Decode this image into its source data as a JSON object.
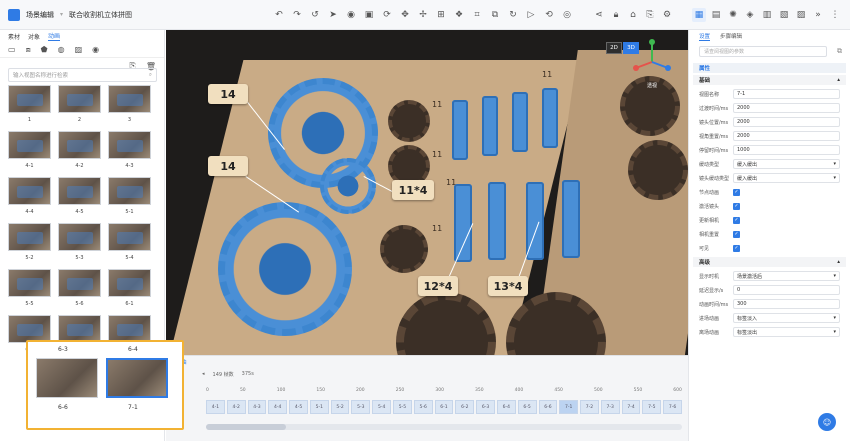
{
  "app": {
    "title": "场景编辑",
    "project": "联合收割机立体拼图"
  },
  "toolbar_icons": [
    "undo-icon",
    "redo-icon",
    "back-icon",
    "cursor-icon",
    "camera-icon",
    "save-icon",
    "rotate-icon",
    "move-icon",
    "scale-icon",
    "grid-icon",
    "explode-icon",
    "crop-icon",
    "link-icon",
    "refresh-icon",
    "play-icon",
    "loop-icon",
    "record-icon"
  ],
  "left": {
    "tabs": [
      "素材",
      "对象",
      "动画"
    ],
    "active_tab": 2,
    "search_placeholder": "输入视图名称进行检索",
    "thumbs": [
      "1",
      "2",
      "3",
      "4-1",
      "4-2",
      "4-3",
      "4-4",
      "4-5",
      "5-1",
      "5-2",
      "5-3",
      "5-4",
      "5-5",
      "5-6",
      "6-1",
      "6-2",
      "6-3",
      "6-4"
    ]
  },
  "canvas": {
    "view_2d": "2D",
    "view_3d": "3D",
    "tags": [
      "14",
      "14",
      "11*4",
      "12*4",
      "13*4"
    ],
    "numbers": [
      "11",
      "11",
      "11",
      "11",
      "11"
    ],
    "gizmo_label": "透视"
  },
  "timeline": {
    "tab": "时间轴",
    "duration": "149 帧数",
    "fps": "375s",
    "ruler": [
      "0",
      "50",
      "100",
      "150",
      "200",
      "250",
      "300",
      "350",
      "400",
      "450",
      "500",
      "550",
      "600"
    ],
    "segments": [
      "4-1",
      "4-2",
      "4-3",
      "4-4",
      "4-5",
      "5-1",
      "5-2",
      "5-3",
      "5-4",
      "5-5",
      "5-6",
      "6-1",
      "6-2",
      "6-3",
      "6-4",
      "6-5",
      "6-6",
      "7-1",
      "7-2",
      "7-3",
      "7-4",
      "7-5",
      "7-6"
    ],
    "current": "7-1"
  },
  "right": {
    "tabs": [
      "设置",
      "步骤编辑"
    ],
    "search_placeholder": "请查阅视图的参数",
    "section_attr": "属性",
    "section_basic": "基础",
    "props": [
      {
        "label": "视图名称",
        "value": "7-1"
      },
      {
        "label": "过渡时间/ms",
        "value": "2000"
      },
      {
        "label": "镜头位置/ms",
        "value": "2000"
      },
      {
        "label": "视角重置/ms",
        "value": "2000"
      },
      {
        "label": "停留时间/ms",
        "value": "1000"
      },
      {
        "label": "缓动类型",
        "value": "缓入缓出"
      },
      {
        "label": "镜头缓动类型",
        "value": "缓入缓出"
      }
    ],
    "checks": [
      "节点动画",
      "激活镜头",
      "更新相机",
      "相机重置",
      "可见"
    ],
    "section_adv": "高级",
    "adv": [
      {
        "label": "显示时机",
        "value": "场景激活后"
      },
      {
        "label": "延迟显示/s",
        "value": "0"
      },
      {
        "label": "动画时间/ms",
        "value": "300"
      },
      {
        "label": "进场动画",
        "value": "标签淡入"
      },
      {
        "label": "离场动画",
        "value": "标签淡出"
      }
    ]
  },
  "popup": {
    "labels": [
      "6-3",
      "6-4",
      "6-6",
      "7-1"
    ]
  },
  "colors": {
    "accent": "#2f7be5",
    "highlight": "#f2b233",
    "piece": "#4a8fd6",
    "board": "#c9ab86"
  }
}
